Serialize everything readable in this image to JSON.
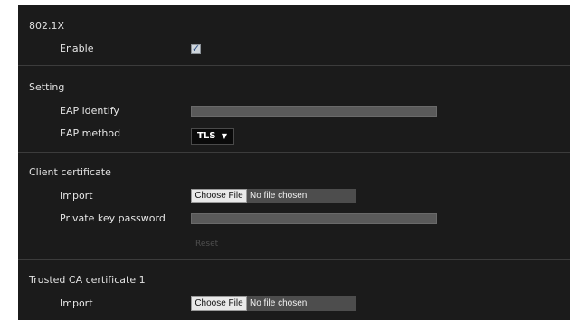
{
  "sections": {
    "dot1x": {
      "title": "802.1X",
      "enable_label": "Enable",
      "enable_checked": true,
      "check_glyph": "✓"
    },
    "setting": {
      "title": "Setting",
      "eap_identify_label": "EAP identify",
      "eap_identify_value": "",
      "eap_method_label": "EAP method",
      "eap_method_value": "TLS",
      "dropdown_arrow": "▼"
    },
    "client_cert": {
      "title": "Client certificate",
      "import_label": "Import",
      "choose_file_label": "Choose File",
      "file_status": "No file chosen",
      "private_key_label": "Private key password",
      "private_key_value": "",
      "reset_label": "Reset"
    },
    "trusted_ca": {
      "title": "Trusted CA certificate 1",
      "import_label": "Import",
      "choose_file_label": "Choose File",
      "file_status": "No file chosen"
    }
  },
  "colors": {
    "panel_bg": "#1b1b1b",
    "field_bg": "#5a5a5a",
    "select_bg": "#0a0a0a"
  }
}
